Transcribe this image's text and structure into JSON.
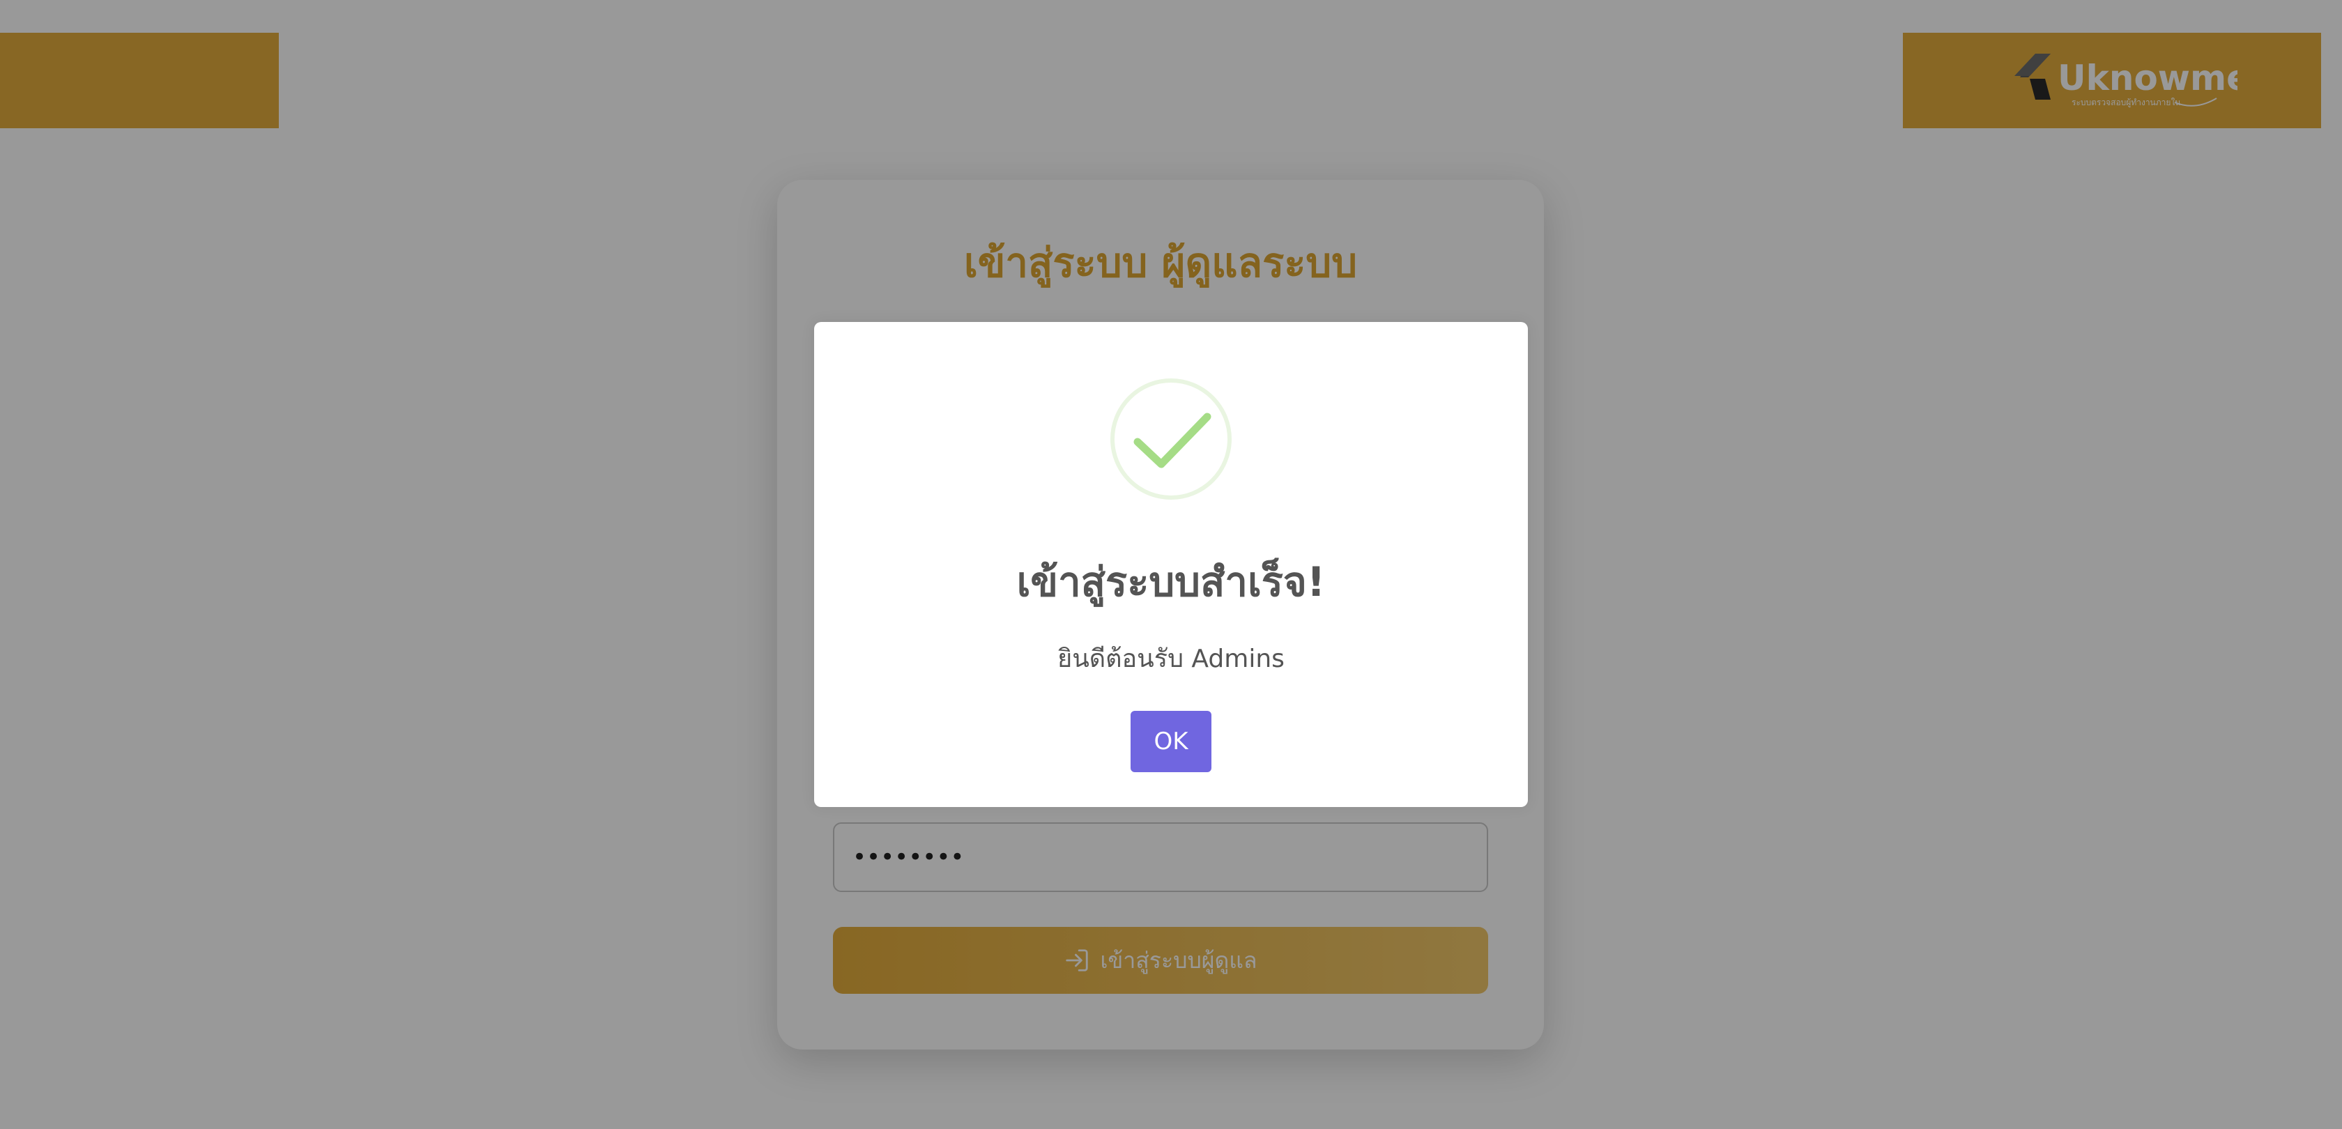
{
  "header": {
    "logo_text": "Uknowme",
    "logo_tagline": "ระบบตรวจสอบผู้ทำงานภายใน"
  },
  "login_card": {
    "title": "เข้าสู่ระบบ ผู้ดูแลระบบ",
    "password_value": "••••••••",
    "submit_label": "เข้าสู่ระบบผู้ดูแล"
  },
  "dialog": {
    "title": "เข้าสู่ระบบสำเร็จ!",
    "message": "ยินดีต้อนรับ Admins",
    "ok_label": "OK"
  },
  "colors": {
    "brand_gold": "#e3ac3c",
    "dialog_confirm": "#7066e0",
    "success_green": "#a5dc86"
  },
  "icons": {
    "success": "check-circle-icon",
    "login": "sign-in-icon",
    "logo": "uknowme-logo"
  }
}
